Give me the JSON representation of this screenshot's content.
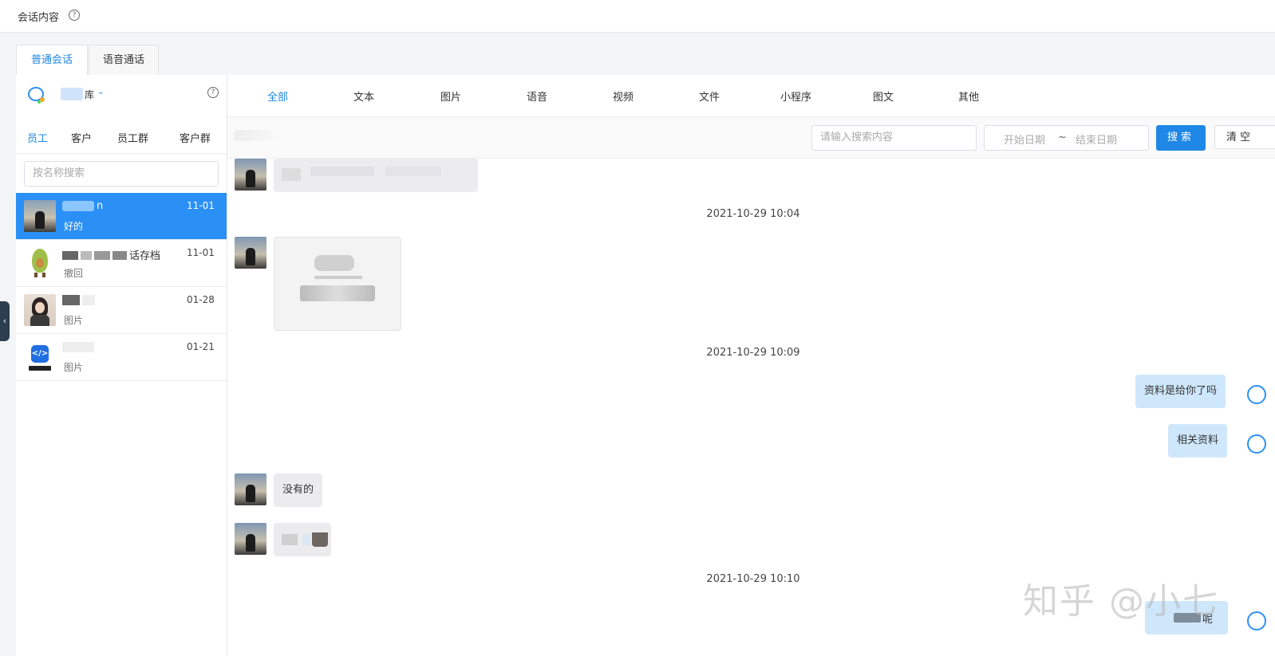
{
  "header": {
    "title": "会话内容",
    "help_icon": "question-circle-icon"
  },
  "main_tabs": [
    {
      "label": "普通会话",
      "active": true
    },
    {
      "label": "语音通话",
      "active": false
    }
  ],
  "sidebar": {
    "account_suffix": "库",
    "sub_tabs": [
      {
        "label": "员工",
        "active": true
      },
      {
        "label": "客户",
        "active": false
      },
      {
        "label": "员工群",
        "active": false
      },
      {
        "label": "客户群",
        "active": false
      }
    ],
    "search_placeholder": "按名称搜索",
    "conversations": [
      {
        "name_suffix": "n",
        "time": "11-01",
        "last": "好的",
        "active": true
      },
      {
        "name_suffix": "话存档",
        "time": "11-01",
        "last": "撤回",
        "active": false
      },
      {
        "name_suffix": "",
        "time": "01-28",
        "last": "图片",
        "active": false
      },
      {
        "name_suffix": "",
        "time": "01-21",
        "last": "图片",
        "active": false
      }
    ]
  },
  "type_tabs": [
    {
      "label": "全部",
      "active": true
    },
    {
      "label": "文本",
      "active": false
    },
    {
      "label": "图片",
      "active": false
    },
    {
      "label": "语音",
      "active": false
    },
    {
      "label": "视频",
      "active": false
    },
    {
      "label": "文件",
      "active": false
    },
    {
      "label": "小程序",
      "active": false
    },
    {
      "label": "图文",
      "active": false
    },
    {
      "label": "其他",
      "active": false
    }
  ],
  "filter": {
    "keyword_placeholder": "请输入搜索内容",
    "start_date_placeholder": "开始日期",
    "separator": "~",
    "end_date_placeholder": "结束日期",
    "search_label": "搜索",
    "clear_label": "清空"
  },
  "messages": {
    "timestamps": [
      "2021-10-29 10:04",
      "2021-10-29 10:09",
      "2021-10-29 10:10"
    ],
    "self_msg_1": "资料是给你了吗",
    "self_msg_2": "相关资料",
    "other_msg_text": "没有的",
    "self_msg_last_suffix": "呢"
  },
  "watermark": "知乎 @小七",
  "colors": {
    "accent": "#1f87e6",
    "active_row": "#2b90f5",
    "self_bubble": "#cfe7fb",
    "other_bubble": "#ececef"
  }
}
